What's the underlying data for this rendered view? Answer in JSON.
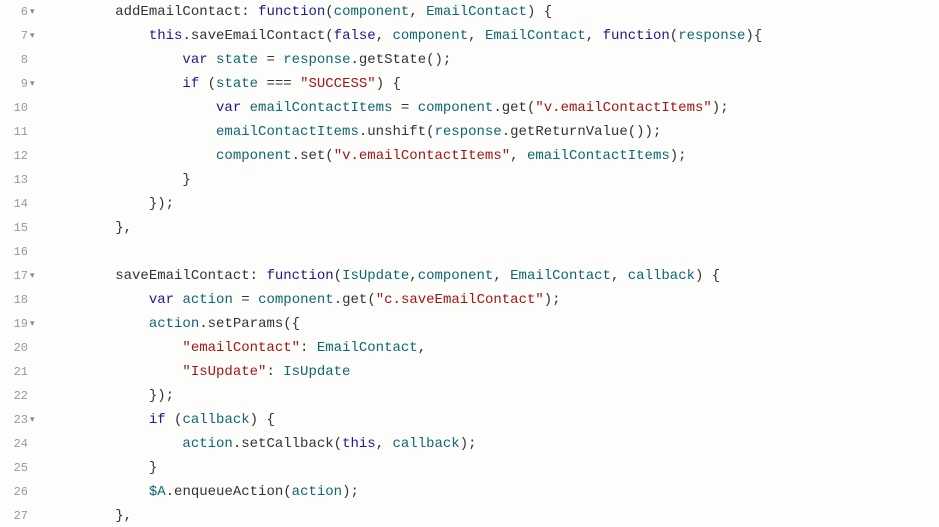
{
  "lines": [
    {
      "num": 6,
      "fold": "▾",
      "indent": 2,
      "tokens": [
        [
          "prop",
          "addEmailContact"
        ],
        [
          "punc",
          ": "
        ],
        [
          "keyword",
          "function"
        ],
        [
          "punc",
          "("
        ],
        [
          "ident",
          "component"
        ],
        [
          "punc",
          ", "
        ],
        [
          "ident",
          "EmailContact"
        ],
        [
          "punc",
          ") {"
        ]
      ]
    },
    {
      "num": 7,
      "fold": "▾",
      "indent": 3,
      "tokens": [
        [
          "this",
          "this"
        ],
        [
          "punc",
          "."
        ],
        [
          "prop",
          "saveEmailContact"
        ],
        [
          "punc",
          "("
        ],
        [
          "const",
          "false"
        ],
        [
          "punc",
          ", "
        ],
        [
          "ident",
          "component"
        ],
        [
          "punc",
          ", "
        ],
        [
          "ident",
          "EmailContact"
        ],
        [
          "punc",
          ", "
        ],
        [
          "keyword",
          "function"
        ],
        [
          "punc",
          "("
        ],
        [
          "ident",
          "response"
        ],
        [
          "punc",
          "){"
        ]
      ]
    },
    {
      "num": 8,
      "fold": "",
      "indent": 4,
      "tokens": [
        [
          "keyword",
          "var"
        ],
        [
          "punc",
          " "
        ],
        [
          "ident",
          "state"
        ],
        [
          "punc",
          " = "
        ],
        [
          "ident",
          "response"
        ],
        [
          "punc",
          "."
        ],
        [
          "prop",
          "getState"
        ],
        [
          "punc",
          "();"
        ]
      ]
    },
    {
      "num": 9,
      "fold": "▾",
      "indent": 4,
      "tokens": [
        [
          "keyword",
          "if"
        ],
        [
          "punc",
          " ("
        ],
        [
          "ident",
          "state"
        ],
        [
          "punc",
          " === "
        ],
        [
          "string",
          "\"SUCCESS\""
        ],
        [
          "punc",
          ") {"
        ]
      ]
    },
    {
      "num": 10,
      "fold": "",
      "indent": 5,
      "tokens": [
        [
          "keyword",
          "var"
        ],
        [
          "punc",
          " "
        ],
        [
          "ident",
          "emailContactItems"
        ],
        [
          "punc",
          " = "
        ],
        [
          "ident",
          "component"
        ],
        [
          "punc",
          "."
        ],
        [
          "prop",
          "get"
        ],
        [
          "punc",
          "("
        ],
        [
          "string",
          "\"v.emailContactItems\""
        ],
        [
          "punc",
          ");"
        ]
      ]
    },
    {
      "num": 11,
      "fold": "",
      "indent": 5,
      "tokens": [
        [
          "ident",
          "emailContactItems"
        ],
        [
          "punc",
          "."
        ],
        [
          "prop",
          "unshift"
        ],
        [
          "punc",
          "("
        ],
        [
          "ident",
          "response"
        ],
        [
          "punc",
          "."
        ],
        [
          "prop",
          "getReturnValue"
        ],
        [
          "punc",
          "());"
        ]
      ]
    },
    {
      "num": 12,
      "fold": "",
      "indent": 5,
      "tokens": [
        [
          "ident",
          "component"
        ],
        [
          "punc",
          "."
        ],
        [
          "prop",
          "set"
        ],
        [
          "punc",
          "("
        ],
        [
          "string",
          "\"v.emailContactItems\""
        ],
        [
          "punc",
          ", "
        ],
        [
          "ident",
          "emailContactItems"
        ],
        [
          "punc",
          ");"
        ]
      ]
    },
    {
      "num": 13,
      "fold": "",
      "indent": 4,
      "tokens": [
        [
          "punc",
          "}"
        ]
      ]
    },
    {
      "num": 14,
      "fold": "",
      "indent": 3,
      "tokens": [
        [
          "punc",
          "});"
        ]
      ]
    },
    {
      "num": 15,
      "fold": "",
      "indent": 2,
      "tokens": [
        [
          "punc",
          "},"
        ]
      ]
    },
    {
      "num": 16,
      "fold": "",
      "indent": 0,
      "tokens": []
    },
    {
      "num": 17,
      "fold": "▾",
      "indent": 2,
      "tokens": [
        [
          "prop",
          "saveEmailContact"
        ],
        [
          "punc",
          ": "
        ],
        [
          "keyword",
          "function"
        ],
        [
          "punc",
          "("
        ],
        [
          "ident",
          "IsUpdate"
        ],
        [
          "punc",
          ","
        ],
        [
          "ident",
          "component"
        ],
        [
          "punc",
          ", "
        ],
        [
          "ident",
          "EmailContact"
        ],
        [
          "punc",
          ", "
        ],
        [
          "ident",
          "callback"
        ],
        [
          "punc",
          ") {"
        ]
      ]
    },
    {
      "num": 18,
      "fold": "",
      "indent": 3,
      "tokens": [
        [
          "keyword",
          "var"
        ],
        [
          "punc",
          " "
        ],
        [
          "ident",
          "action"
        ],
        [
          "punc",
          " = "
        ],
        [
          "ident",
          "component"
        ],
        [
          "punc",
          "."
        ],
        [
          "prop",
          "get"
        ],
        [
          "punc",
          "("
        ],
        [
          "string",
          "\"c.saveEmailContact\""
        ],
        [
          "punc",
          ");"
        ]
      ]
    },
    {
      "num": 19,
      "fold": "▾",
      "indent": 3,
      "tokens": [
        [
          "ident",
          "action"
        ],
        [
          "punc",
          "."
        ],
        [
          "prop",
          "setParams"
        ],
        [
          "punc",
          "({"
        ]
      ]
    },
    {
      "num": 20,
      "fold": "",
      "indent": 4,
      "tokens": [
        [
          "string",
          "\"emailContact\""
        ],
        [
          "punc",
          ": "
        ],
        [
          "ident",
          "EmailContact"
        ],
        [
          "punc",
          ","
        ]
      ]
    },
    {
      "num": 21,
      "fold": "",
      "indent": 4,
      "tokens": [
        [
          "string",
          "\"IsUpdate\""
        ],
        [
          "punc",
          ": "
        ],
        [
          "ident",
          "IsUpdate"
        ]
      ]
    },
    {
      "num": 22,
      "fold": "",
      "indent": 3,
      "tokens": [
        [
          "punc",
          "});"
        ]
      ]
    },
    {
      "num": 23,
      "fold": "▾",
      "indent": 3,
      "tokens": [
        [
          "keyword",
          "if"
        ],
        [
          "punc",
          " ("
        ],
        [
          "ident",
          "callback"
        ],
        [
          "punc",
          ") {"
        ]
      ]
    },
    {
      "num": 24,
      "fold": "",
      "indent": 4,
      "tokens": [
        [
          "ident",
          "action"
        ],
        [
          "punc",
          "."
        ],
        [
          "prop",
          "setCallback"
        ],
        [
          "punc",
          "("
        ],
        [
          "this",
          "this"
        ],
        [
          "punc",
          ", "
        ],
        [
          "ident",
          "callback"
        ],
        [
          "punc",
          ");"
        ]
      ]
    },
    {
      "num": 25,
      "fold": "",
      "indent": 3,
      "tokens": [
        [
          "punc",
          "}"
        ]
      ]
    },
    {
      "num": 26,
      "fold": "",
      "indent": 3,
      "tokens": [
        [
          "ident",
          "$A"
        ],
        [
          "punc",
          "."
        ],
        [
          "prop",
          "enqueueAction"
        ],
        [
          "punc",
          "("
        ],
        [
          "ident",
          "action"
        ],
        [
          "punc",
          ");"
        ]
      ]
    },
    {
      "num": 27,
      "fold": "",
      "indent": 2,
      "tokens": [
        [
          "punc",
          "},"
        ]
      ]
    }
  ]
}
